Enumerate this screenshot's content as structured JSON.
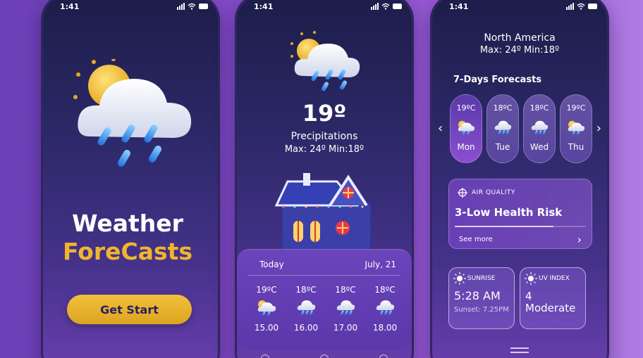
{
  "phones": [
    {
      "status_time": "1:41",
      "title": "Weather",
      "subtitle": "ForeCasts",
      "button_label": "Get Start"
    },
    {
      "status_time": "1:41",
      "temperature": "19º",
      "condition": "Precipitations",
      "minmax": "Max: 24º   Min:18º",
      "today_label": "Today",
      "today_date": "July, 21",
      "hourly": [
        {
          "temp": "19ºC",
          "time": "15.00",
          "icon": "partly-cloudy-rain-icon"
        },
        {
          "temp": "18ºC",
          "time": "16.00",
          "icon": "cloud-rain-icon"
        },
        {
          "temp": "18ºC",
          "time": "17.00",
          "icon": "cloud-rain-icon"
        },
        {
          "temp": "18ºC",
          "time": "18.00",
          "icon": "cloud-rain-icon"
        }
      ]
    },
    {
      "status_time": "1:41",
      "region": "North America",
      "minmax": "Max: 24º   Min:18º",
      "forecast_heading": "7-Days Forecasts",
      "days": [
        {
          "temp": "19ºC",
          "day": "Mon",
          "icon": "partly-cloudy-rain-icon",
          "active": true
        },
        {
          "temp": "18ºC",
          "day": "Tue",
          "icon": "cloud-rain-icon",
          "active": false
        },
        {
          "temp": "18ºC",
          "day": "Wed",
          "icon": "cloud-rain-icon",
          "active": false
        },
        {
          "temp": "19ºC",
          "day": "Thu",
          "icon": "partly-cloudy-rain-icon",
          "active": false
        }
      ],
      "air_quality": {
        "label": "AIR QUALITY",
        "value": "3-Low Health Risk",
        "level": 0.75,
        "more": "See more"
      },
      "sunrise": {
        "label": "SUNRISE",
        "time": "5:28 AM",
        "sunset": "Sunset: 7.25PM"
      },
      "uv": {
        "label": "UV INDEX",
        "value": "4",
        "level_text": "Moderate"
      }
    }
  ],
  "colors": {
    "accent_yellow": "#f0b52e",
    "button_text": "#2a1f63",
    "phone_top": "#1d1d4a",
    "phone_bottom": "#6a3fb0"
  }
}
